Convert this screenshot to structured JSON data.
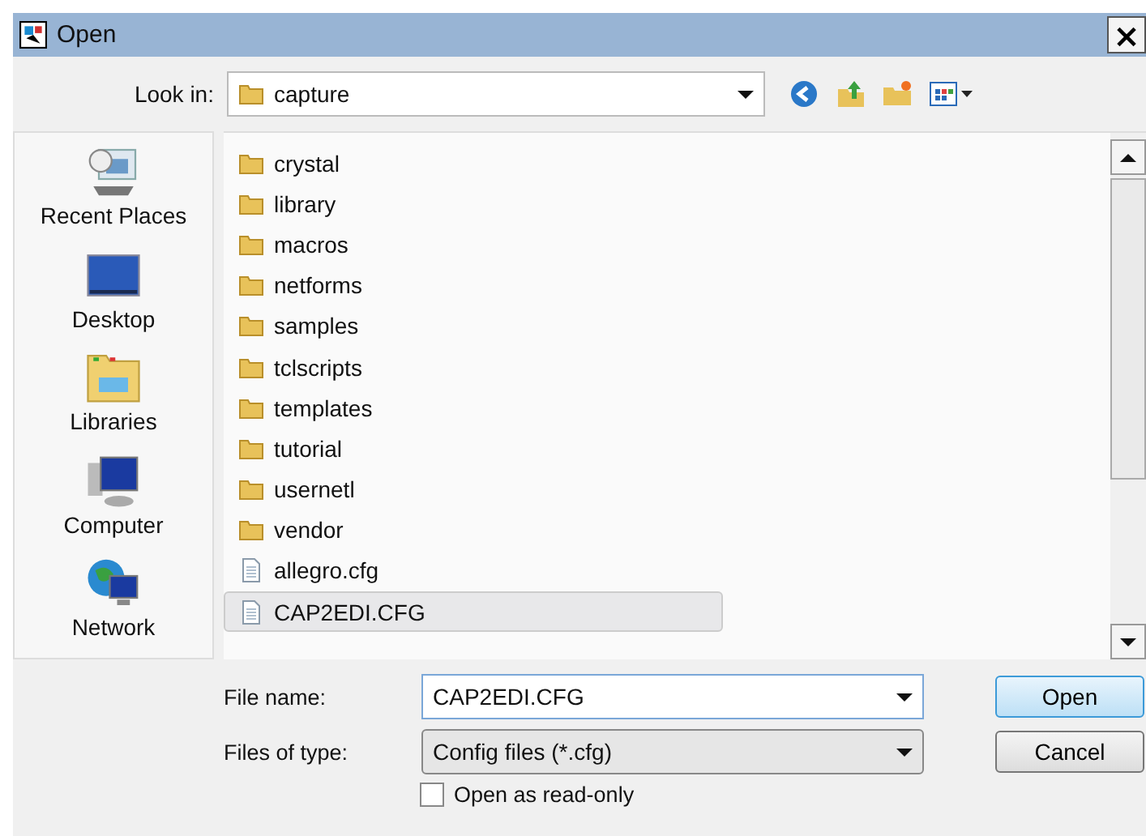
{
  "window": {
    "title": "Open",
    "close": "×"
  },
  "look_in": {
    "label": "Look in:",
    "value": "capture"
  },
  "places": [
    {
      "label": "Recent Places",
      "kind": "recent"
    },
    {
      "label": "Desktop",
      "kind": "desktop"
    },
    {
      "label": "Libraries",
      "kind": "libraries"
    },
    {
      "label": "Computer",
      "kind": "computer"
    },
    {
      "label": "Network",
      "kind": "network"
    }
  ],
  "files": [
    {
      "name": "crystal",
      "kind": "folder",
      "selected": false
    },
    {
      "name": "library",
      "kind": "folder",
      "selected": false
    },
    {
      "name": "macros",
      "kind": "folder",
      "selected": false
    },
    {
      "name": "netforms",
      "kind": "folder",
      "selected": false
    },
    {
      "name": "samples",
      "kind": "folder",
      "selected": false
    },
    {
      "name": "tclscripts",
      "kind": "folder",
      "selected": false
    },
    {
      "name": "templates",
      "kind": "folder",
      "selected": false
    },
    {
      "name": "tutorial",
      "kind": "folder",
      "selected": false
    },
    {
      "name": "usernetl",
      "kind": "folder",
      "selected": false
    },
    {
      "name": "vendor",
      "kind": "folder",
      "selected": false
    },
    {
      "name": "allegro.cfg",
      "kind": "file",
      "selected": false
    },
    {
      "name": "CAP2EDI.CFG",
      "kind": "file",
      "selected": true
    }
  ],
  "file_name": {
    "label": "File name:",
    "value": "CAP2EDI.CFG"
  },
  "file_type": {
    "label": "Files of type:",
    "value": "Config files (*.cfg)"
  },
  "read_only": {
    "label": "Open as read-only",
    "checked": false
  },
  "buttons": [
    {
      "label": "Open",
      "kind": "default"
    },
    {
      "label": "Cancel",
      "kind": "normal"
    }
  ]
}
